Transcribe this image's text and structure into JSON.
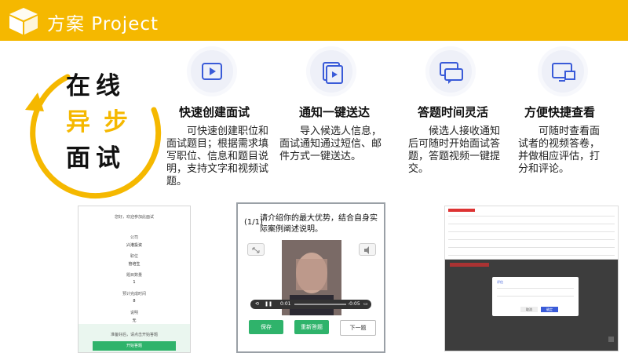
{
  "header": {
    "title": "方案 Project"
  },
  "hero": {
    "chars": [
      "在",
      "线",
      "异",
      "步",
      "面",
      "试"
    ]
  },
  "features": [
    {
      "icon": "video-play-icon",
      "title": "快速创建面试",
      "desc": "可快速创建职位和面试题目；根据需求填写职位、信息和题目说明，支持文字和视频试题。"
    },
    {
      "icon": "video-share-icon",
      "title": "通知一键送达",
      "desc": "导入候选人信息，面试通知通过短信、邮件方式一键送达。"
    },
    {
      "icon": "chat-bubble-icon",
      "title": "答题时间灵活",
      "desc": "候选人接收通知后可随时开始面试答题，答题视频一键提交。"
    },
    {
      "icon": "screen-view-icon",
      "title": "方便快捷查看",
      "desc": "可随时查看面试者的视频答卷，并做相应评估，打分和评论。"
    }
  ],
  "shot1": {
    "greeting": "您好，欢迎参加此面试",
    "fields": [
      {
        "label": "公司",
        "value": "兴港投资"
      },
      {
        "label": "职位",
        "value": "管培生"
      },
      {
        "label": "题目数量",
        "value": "1"
      },
      {
        "label": "预计完成时间",
        "value": "8"
      },
      {
        "label": "说明",
        "value": "无"
      }
    ],
    "ready": "准备好后，请点击开始答题",
    "start": "开始答题"
  },
  "shot2": {
    "qnum": "(1/1)",
    "question": "请介绍你的最大优势，结合自身实际案例阐述说明。",
    "time_current": "0:01",
    "time_remaining": "-0:05",
    "buttons": {
      "save": "保存",
      "retry": "重新答题",
      "next": "下一题"
    }
  },
  "shot3": {
    "dialog_title": "评估",
    "confirm": "确定",
    "cancel": "取消"
  },
  "colors": {
    "accent": "#f5b800",
    "green": "#2fb36b",
    "dark": "#3d3d3d"
  }
}
